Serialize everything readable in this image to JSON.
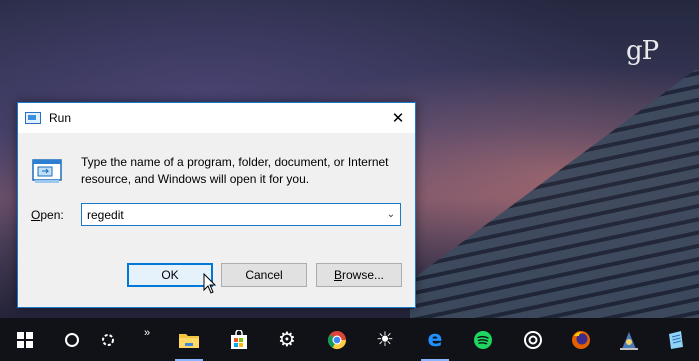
{
  "watermark": "gP",
  "dialog": {
    "title": "Run",
    "close_glyph": "✕",
    "description_line1": "Type the name of a program, folder, document, or Internet",
    "description_line2": "resource, and Windows will open it for you.",
    "open_label_prefix": "",
    "open_label_accel": "O",
    "open_label_rest": "pen:",
    "open_value": "regedit",
    "ok_label": "OK",
    "cancel_label": "Cancel",
    "browse_accel": "B",
    "browse_rest": "rowse..."
  },
  "taskbar": {
    "items": [
      {
        "icon": "windows-start-icon"
      },
      {
        "icon": "cortana-search-icon"
      },
      {
        "icon": "task-view-icon"
      },
      {
        "icon": "overflow-icon"
      },
      {
        "icon": "file-explorer-icon"
      },
      {
        "icon": "store-icon"
      },
      {
        "icon": "settings-gear-icon"
      },
      {
        "icon": "chrome-icon"
      },
      {
        "icon": "brightness-icon"
      },
      {
        "icon": "edge-icon"
      },
      {
        "icon": "spotify-icon"
      },
      {
        "icon": "groove-icon"
      },
      {
        "icon": "firefox-icon"
      },
      {
        "icon": "wizard-icon"
      },
      {
        "icon": "notes-icon"
      }
    ]
  }
}
